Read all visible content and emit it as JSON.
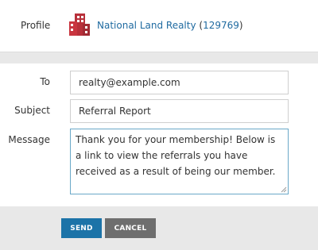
{
  "profile": {
    "label": "Profile",
    "name": "National Land Realty",
    "id_open": " (",
    "id": "129769",
    "id_close": ")",
    "logo_icon": "building-icon",
    "logo_color": "#b8303a"
  },
  "form": {
    "to_label": "To",
    "to_value": "realty@example.com",
    "subject_label": "Subject",
    "subject_value": "Referral Report",
    "message_label": "Message",
    "message_value": "Thank you for your membership! Below is a link to view the referrals you have received as a result of being our member."
  },
  "actions": {
    "send_label": "SEND",
    "cancel_label": "CANCEL"
  },
  "colors": {
    "send": "#1c73a8",
    "cancel": "#6e6e6e",
    "link": "#1f6aa0",
    "background": "#e8e8e8"
  }
}
